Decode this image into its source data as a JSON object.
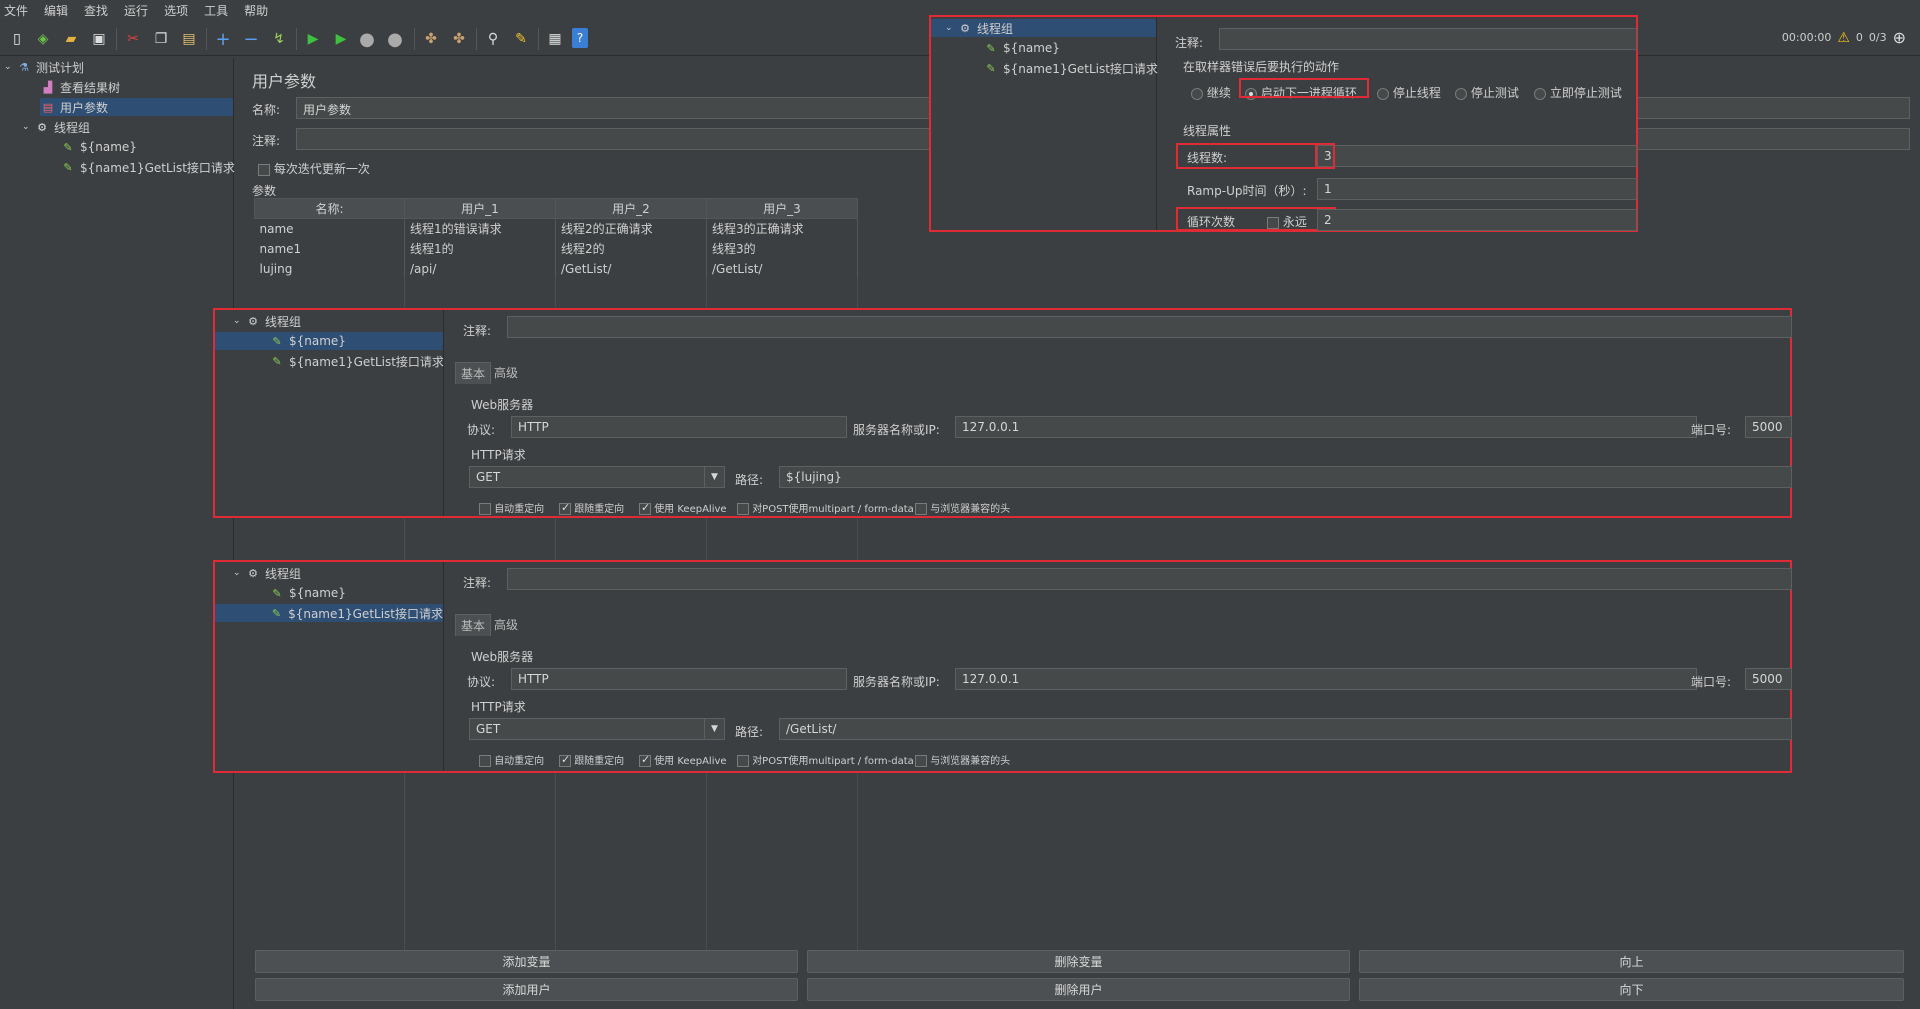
{
  "menu": [
    "文件",
    "编辑",
    "查找",
    "运行",
    "选项",
    "工具",
    "帮助"
  ],
  "status": {
    "time": "00:00:00",
    "warn_count": "0",
    "threads": "0/3"
  },
  "tree": {
    "root": "测试计划",
    "listener": "查看结果树",
    "params": "用户参数",
    "threadgroup": "线程组",
    "sampler1": "${name}",
    "sampler2": "${name1}GetList接口请求"
  },
  "main": {
    "title": "用户参数",
    "name_label": "名称:",
    "name_value": "用户参数",
    "comment_label": "注释:",
    "update_each_iter": "每次迭代更新一次",
    "params_label": "参数",
    "table": {
      "headers": [
        "名称:",
        "用户_1",
        "用户_2",
        "用户_3"
      ],
      "rows": [
        [
          "name",
          "线程1的错误请求",
          "线程2的正确请求",
          "线程3的正确请求"
        ],
        [
          "name1",
          "线程1的",
          "线程2的",
          "线程3的"
        ],
        [
          "lujing",
          "/api/",
          "/GetList/",
          "/GetList/"
        ]
      ]
    },
    "buttons": {
      "add_var": "添加变量",
      "del_var": "删除变量",
      "up": "向上",
      "add_user": "添加用户",
      "del_user": "删除用户",
      "down": "向下"
    }
  },
  "tg_overlay": {
    "tree_root": "线程组",
    "tree_c1": "${name}",
    "tree_c2": "${name1}GetList接口请求",
    "comment_label": "注释:",
    "action_title": "在取样器错误后要执行的动作",
    "actions": [
      "继续",
      "启动下一进程循环",
      "停止线程",
      "停止测试",
      "立即停止测试"
    ],
    "props_title": "线程属性",
    "threads_label": "线程数:",
    "threads_value": "3",
    "rampup_label": "Ramp-Up时间（秒）:",
    "rampup_value": "1",
    "loop_label": "循环次数",
    "forever_label": "永远",
    "loop_value": "2"
  },
  "http1": {
    "tree_root": "线程组",
    "tree_c1": "${name}",
    "tree_c2": "${name1}GetList接口请求",
    "comment_label": "注释:",
    "tab_basic": "基本",
    "tab_adv": "高级",
    "web_server": "Web服务器",
    "proto_label": "协议:",
    "proto_value": "HTTP",
    "server_label": "服务器名称或IP:",
    "server_value": "127.0.0.1",
    "port_label": "端口号:",
    "port_value": "5000",
    "http_req": "HTTP请求",
    "method": "GET",
    "path_label": "路径:",
    "path_value": "${lujing}",
    "opts": [
      "自动重定向",
      "跟随重定向",
      "使用 KeepAlive",
      "对POST使用multipart / form-data",
      "与浏览器兼容的头"
    ]
  },
  "http2": {
    "tree_root": "线程组",
    "tree_c1": "${name}",
    "tree_c2": "${name1}GetList接口请求",
    "comment_label": "注释:",
    "tab_basic": "基本",
    "tab_adv": "高级",
    "web_server": "Web服务器",
    "proto_label": "协议:",
    "proto_value": "HTTP",
    "server_label": "服务器名称或IP:",
    "server_value": "127.0.0.1",
    "port_label": "端口号:",
    "port_value": "5000",
    "http_req": "HTTP请求",
    "method": "GET",
    "path_label": "路径:",
    "path_value": "/GetList/",
    "opts": [
      "自动重定向",
      "跟随重定向",
      "使用 KeepAlive",
      "对POST使用multipart / form-data",
      "与浏览器兼容的头"
    ]
  },
  "colors": {
    "accent_red": "#e02a36",
    "selection": "#2f4e74"
  }
}
